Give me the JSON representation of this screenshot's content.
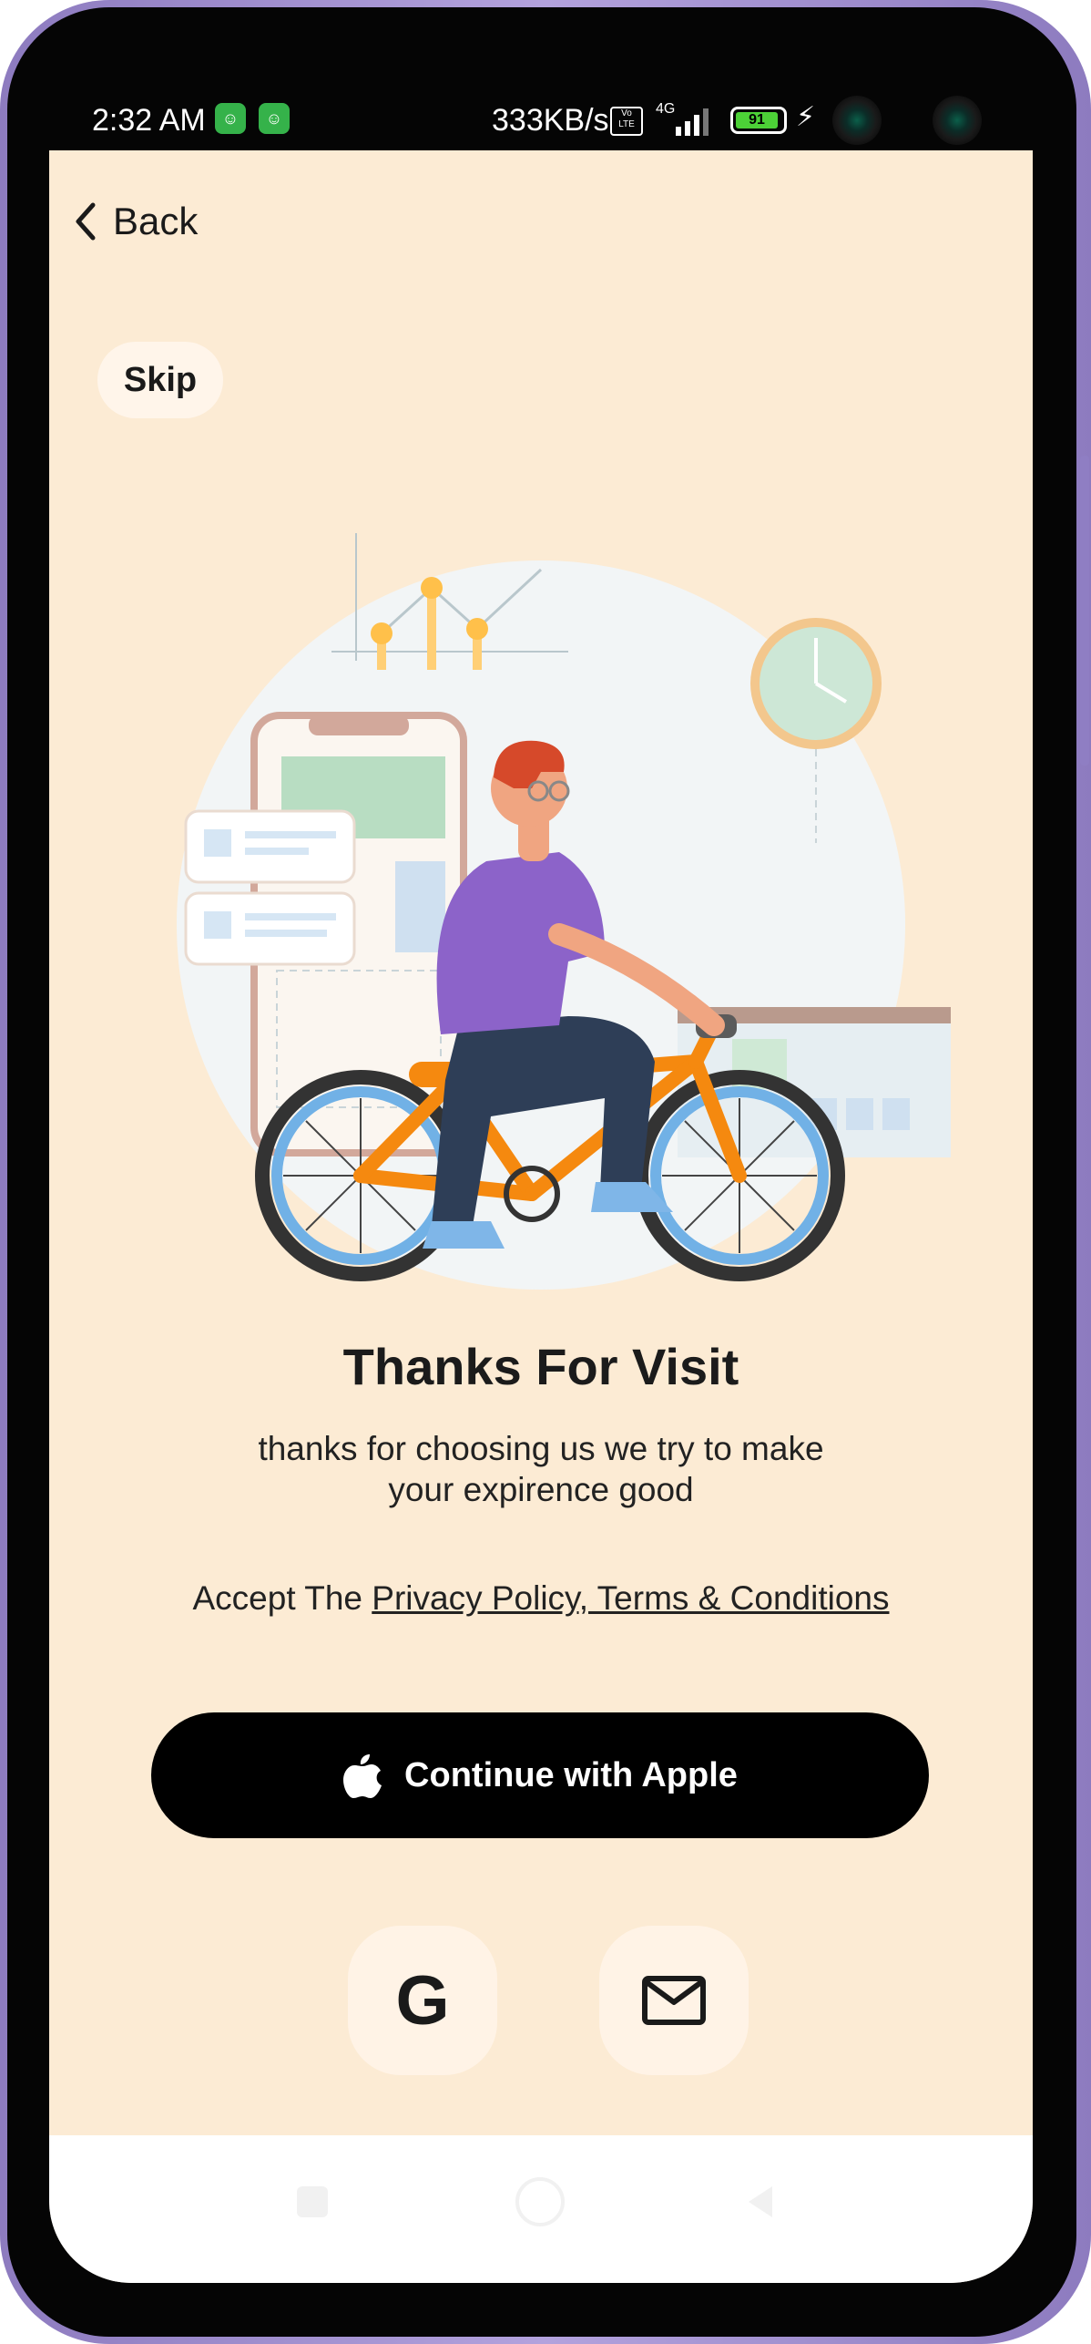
{
  "status_bar": {
    "time": "2:32 AM",
    "network_speed": "333KB/s",
    "volte": "Vo LTE",
    "signal_type": "4G",
    "battery": "91"
  },
  "header": {
    "back_label": "Back"
  },
  "skip_label": "Skip",
  "content": {
    "title": "Thanks For Visit",
    "subtitle": "thanks for choosing us we try to make your expirence good",
    "accept_prefix": "Accept The ",
    "accept_link": "Privacy Policy, Terms & Conditions"
  },
  "buttons": {
    "apple_label": "Continue with Apple",
    "google_label": "G"
  },
  "icons": {
    "back": "chevron-left-icon",
    "apple": "apple-icon",
    "google": "google-icon",
    "email": "mail-icon"
  },
  "colors": {
    "screen_background": "#fcebd4",
    "primary_button": "#000000",
    "secondary_button": "#fff3e6",
    "bike_frame": "#f5890f",
    "shirt": "#8c63c9"
  }
}
